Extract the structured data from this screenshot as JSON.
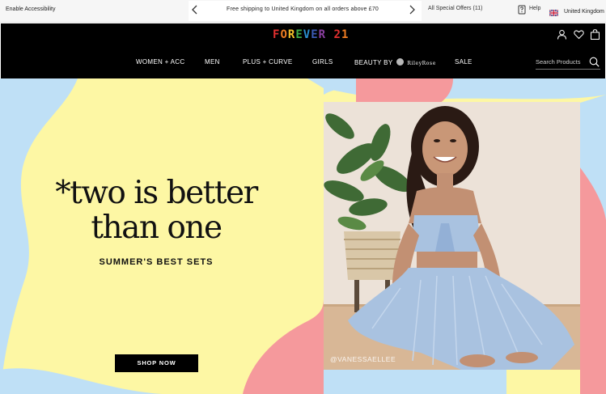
{
  "topbar": {
    "accessibility_label": "Enable Accessibility",
    "promo_text": "Free shipping to United Kingdom on all orders above £70",
    "offers_label": "All Special Offers (11)",
    "help_label": "Help",
    "country_label": "United Kingdom",
    "prev_icon": "chevron-left-icon",
    "next_icon": "chevron-right-icon",
    "help_icon": "help-icon",
    "flag_icon": "uk-flag-icon"
  },
  "header": {
    "logo_letters": [
      "F",
      "O",
      "R",
      "E",
      "V",
      "E",
      "R",
      " ",
      "2",
      "1"
    ],
    "logo_colors": [
      "#e2302f",
      "#ef7d22",
      "#f5c02a",
      "#3daa49",
      "#2a8fd0",
      "#3b5bb5",
      "#8a3fa0",
      "#000000",
      "#e2302f",
      "#ef7d22"
    ],
    "icons": [
      "account-icon",
      "wishlist-heart-icon",
      "shopping-bag-icon"
    ],
    "nav": [
      {
        "label": "WOMEN + ACC"
      },
      {
        "label": "MEN"
      },
      {
        "label": "PLUS + CURVE"
      },
      {
        "label": "GIRLS"
      },
      {
        "label": "BEAUTY BY",
        "brand": "RileyRose"
      },
      {
        "label": "SALE"
      }
    ],
    "search_placeholder": "Search Products",
    "search_icon": "search-icon"
  },
  "hero": {
    "headline_line1": "*two is better",
    "headline_line2": "than one",
    "subtitle": "SUMMER'S BEST SETS",
    "cta_label": "SHOP NOW",
    "photo_credit": "@VANESSAELLEE",
    "colors": {
      "yellow": "#fdf7a4",
      "blue": "#bfe0f6",
      "pink": "#f5999c",
      "black": "#000000"
    }
  }
}
